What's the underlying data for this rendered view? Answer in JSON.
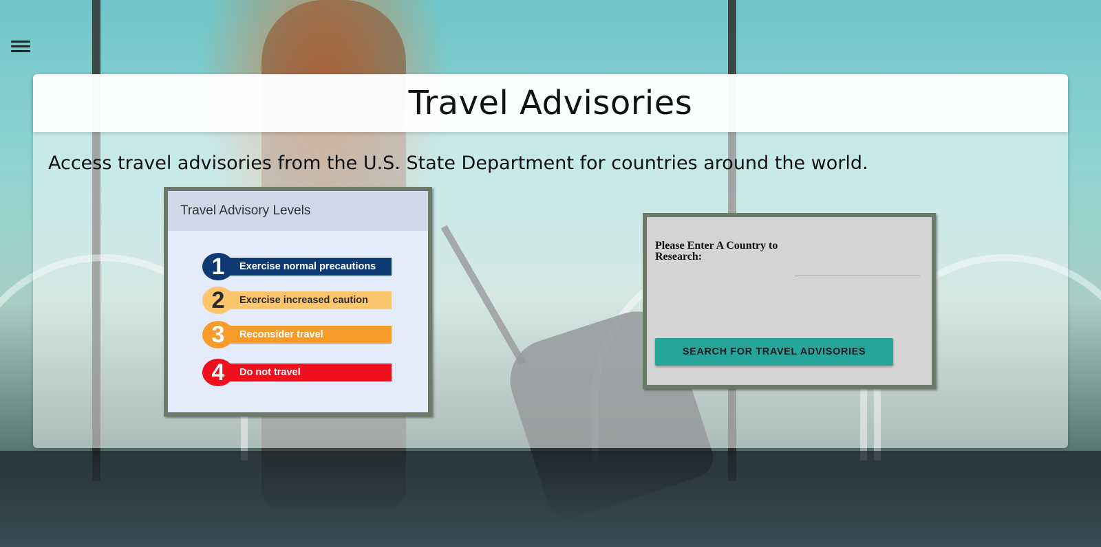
{
  "header": {
    "title": "Travel Advisories"
  },
  "intro_text": "Access travel advisories from the U.S. State Department for countries around the world.",
  "levels_card": {
    "title": "Travel Advisory Levels",
    "levels": [
      {
        "number": "1",
        "label": "Exercise normal precautions",
        "color": "#0d3a73",
        "text_color": "#ffffff"
      },
      {
        "number": "2",
        "label": "Exercise increased caution",
        "color": "#fcc56e",
        "text_color": "#2b2b2b"
      },
      {
        "number": "3",
        "label": "Reconsider travel",
        "color": "#f99b2a",
        "text_color": "#ffffff"
      },
      {
        "number": "4",
        "label": "Do not travel",
        "color": "#f0101e",
        "text_color": "#ffffff"
      }
    ]
  },
  "search_card": {
    "label": "Please Enter A Country to Research:",
    "input_value": "",
    "button_label": "SEARCH FOR TRAVEL ADVISORIES",
    "button_color": "#26a69a"
  },
  "nav": {
    "menu_icon": "hamburger-menu-icon"
  }
}
